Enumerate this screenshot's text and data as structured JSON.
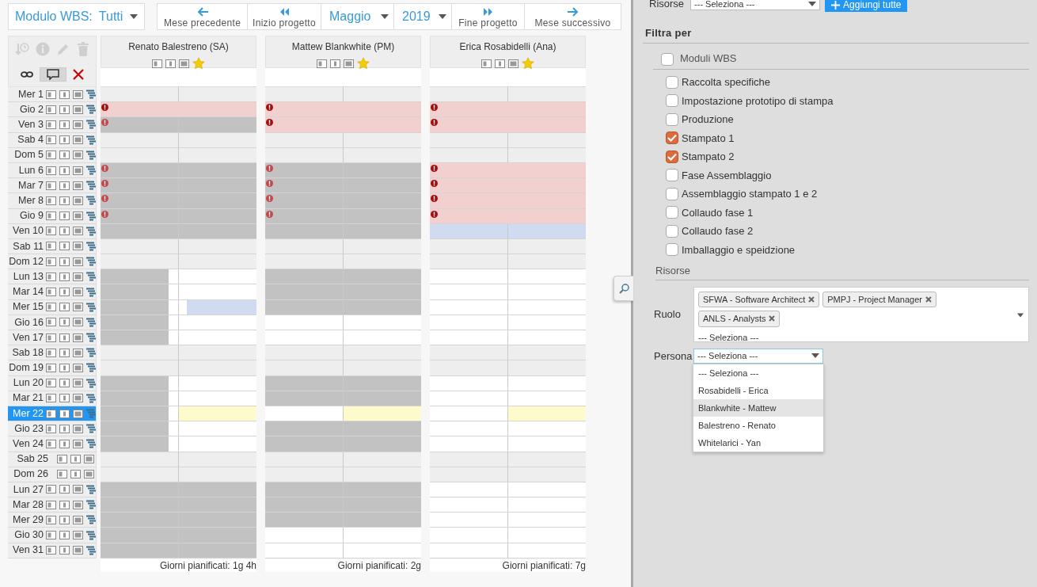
{
  "wbs_filter": {
    "label": "Modulo WBS:",
    "value": "Tutti"
  },
  "nav": [
    {
      "kind": "prev",
      "label": "Mese precedente"
    },
    {
      "kind": "start",
      "label": "Inizio progetto"
    },
    {
      "kind": "select",
      "value": "Maggio"
    },
    {
      "kind": "select",
      "value": "2019"
    },
    {
      "kind": "end",
      "label": "Fine progetto"
    },
    {
      "kind": "next",
      "label": "Mese successivo"
    }
  ],
  "tools": [
    {
      "kind": "history",
      "disabled": true
    },
    {
      "kind": "info",
      "disabled": true
    },
    {
      "kind": "edit",
      "disabled": true
    },
    {
      "kind": "delete",
      "disabled": true
    }
  ],
  "view_tools": [
    {
      "kind": "link",
      "on": false
    },
    {
      "kind": "comment",
      "on": true
    },
    {
      "kind": "clear",
      "on": false
    }
  ],
  "days": [
    {
      "label": "Mer 1",
      "selected": false,
      "gantt": true
    },
    {
      "label": "Gio 2",
      "selected": false,
      "gantt": true
    },
    {
      "label": "Ven 3",
      "selected": false,
      "gantt": true
    },
    {
      "label": "Sab 4",
      "selected": false,
      "gantt": true
    },
    {
      "label": "Dom 5",
      "selected": false,
      "gantt": true
    },
    {
      "label": "Lun 6",
      "selected": false,
      "gantt": true
    },
    {
      "label": "Mar 7",
      "selected": false,
      "gantt": true
    },
    {
      "label": "Mer 8",
      "selected": false,
      "gantt": true
    },
    {
      "label": "Gio 9",
      "selected": false,
      "gantt": true
    },
    {
      "label": "Ven 10",
      "selected": false,
      "gantt": true
    },
    {
      "label": "Sab 11",
      "selected": false,
      "gantt": true
    },
    {
      "label": "Dom 12",
      "selected": false,
      "gantt": true
    },
    {
      "label": "Lun 13",
      "selected": false,
      "gantt": true
    },
    {
      "label": "Mar 14",
      "selected": false,
      "gantt": true
    },
    {
      "label": "Mer 15",
      "selected": false,
      "gantt": true
    },
    {
      "label": "Gio 16",
      "selected": false,
      "gantt": true
    },
    {
      "label": "Ven 17",
      "selected": false,
      "gantt": true
    },
    {
      "label": "Sab 18",
      "selected": false,
      "gantt": true
    },
    {
      "label": "Dom 19",
      "selected": false,
      "gantt": true
    },
    {
      "label": "Lun 20",
      "selected": false,
      "gantt": true
    },
    {
      "label": "Mar 21",
      "selected": false,
      "gantt": true
    },
    {
      "label": "Mer 22",
      "selected": true,
      "gantt": true
    },
    {
      "label": "Gio 23",
      "selected": false,
      "gantt": true
    },
    {
      "label": "Ven 24",
      "selected": false,
      "gantt": true
    },
    {
      "label": "Sab 25",
      "selected": false,
      "gantt": false
    },
    {
      "label": "Dom 26",
      "selected": false,
      "gantt": false
    },
    {
      "label": "Lun 27",
      "selected": false,
      "gantt": true
    },
    {
      "label": "Mar 28",
      "selected": false,
      "gantt": true
    },
    {
      "label": "Mer 29",
      "selected": false,
      "gantt": true
    },
    {
      "label": "Gio 30",
      "selected": false,
      "gantt": true
    },
    {
      "label": "Ven 31",
      "selected": false,
      "gantt": true
    }
  ],
  "people": [
    {
      "name": "Renato Balestreno (SA)",
      "starred": true,
      "total": "Giorni pianificati: 1g 4h",
      "cells": [
        {
          "alert": false,
          "halves": [
            {
              "kind": "off"
            },
            {
              "kind": "off"
            }
          ]
        },
        {
          "alert": true,
          "halves": [
            {
              "kind": "conflict"
            },
            {
              "kind": "conflict"
            }
          ]
        },
        {
          "alert": true,
          "halves": [
            {
              "kind": "busy"
            },
            {
              "kind": "busy"
            }
          ]
        },
        {
          "alert": false,
          "halves": [
            {
              "kind": "off"
            },
            {
              "kind": "off"
            }
          ]
        },
        {
          "alert": false,
          "halves": [
            {
              "kind": "off"
            },
            {
              "kind": "off"
            }
          ]
        },
        {
          "alert": true,
          "halves": [
            {
              "kind": "busy"
            },
            {
              "kind": "busy"
            }
          ]
        },
        {
          "alert": true,
          "halves": [
            {
              "kind": "busy"
            },
            {
              "kind": "busy"
            }
          ]
        },
        {
          "alert": true,
          "halves": [
            {
              "kind": "busy"
            },
            {
              "kind": "busy"
            }
          ]
        },
        {
          "alert": true,
          "halves": [
            {
              "kind": "busy"
            },
            {
              "kind": "busy"
            }
          ]
        },
        {
          "alert": false,
          "halves": [
            {
              "kind": "busy"
            },
            {
              "kind": "busy"
            }
          ]
        },
        {
          "alert": false,
          "halves": [
            {
              "kind": "off"
            },
            {
              "kind": "off"
            }
          ]
        },
        {
          "alert": false,
          "halves": [
            {
              "kind": "off"
            },
            {
              "kind": "off"
            }
          ]
        },
        {
          "alert": false,
          "halves": [
            {
              "kind": "busy_partial"
            },
            {
              "kind": "free"
            }
          ]
        },
        {
          "alert": false,
          "halves": [
            {
              "kind": "busy_partial"
            },
            {
              "kind": "free"
            }
          ]
        },
        {
          "alert": false,
          "halves": [
            {
              "kind": "busy_partial"
            },
            {
              "kind": "planned_partial"
            }
          ]
        },
        {
          "alert": false,
          "halves": [
            {
              "kind": "busy_partial"
            },
            {
              "kind": "free"
            }
          ]
        },
        {
          "alert": false,
          "halves": [
            {
              "kind": "busy_partial"
            },
            {
              "kind": "free"
            }
          ]
        },
        {
          "alert": false,
          "halves": [
            {
              "kind": "off"
            },
            {
              "kind": "off"
            }
          ]
        },
        {
          "alert": false,
          "halves": [
            {
              "kind": "off"
            },
            {
              "kind": "off"
            }
          ]
        },
        {
          "alert": false,
          "halves": [
            {
              "kind": "busy_partial"
            },
            {
              "kind": "free"
            }
          ]
        },
        {
          "alert": false,
          "halves": [
            {
              "kind": "busy_partial"
            },
            {
              "kind": "free"
            }
          ]
        },
        {
          "alert": false,
          "halves": [
            {
              "kind": "busy_partial"
            },
            {
              "kind": "today"
            }
          ]
        },
        {
          "alert": false,
          "halves": [
            {
              "kind": "busy_partial"
            },
            {
              "kind": "free"
            }
          ]
        },
        {
          "alert": false,
          "halves": [
            {
              "kind": "busy_partial"
            },
            {
              "kind": "free"
            }
          ]
        },
        {
          "alert": false,
          "halves": [
            {
              "kind": "off"
            },
            {
              "kind": "off"
            }
          ]
        },
        {
          "alert": false,
          "halves": [
            {
              "kind": "off"
            },
            {
              "kind": "off"
            }
          ]
        },
        {
          "alert": false,
          "halves": [
            {
              "kind": "busy"
            },
            {
              "kind": "busy"
            }
          ]
        },
        {
          "alert": false,
          "halves": [
            {
              "kind": "busy"
            },
            {
              "kind": "busy"
            }
          ]
        },
        {
          "alert": false,
          "halves": [
            {
              "kind": "busy"
            },
            {
              "kind": "busy"
            }
          ]
        },
        {
          "alert": false,
          "halves": [
            {
              "kind": "busy"
            },
            {
              "kind": "busy"
            }
          ]
        },
        {
          "alert": false,
          "halves": [
            {
              "kind": "busy"
            },
            {
              "kind": "busy"
            }
          ]
        }
      ]
    },
    {
      "name": "Mattew Blankwhite (PM)",
      "starred": true,
      "total": "Giorni pianificati: 2g",
      "cells": [
        {
          "alert": false,
          "halves": [
            {
              "kind": "off"
            },
            {
              "kind": "off"
            }
          ]
        },
        {
          "alert": true,
          "halves": [
            {
              "kind": "conflict"
            },
            {
              "kind": "conflict"
            }
          ]
        },
        {
          "alert": true,
          "halves": [
            {
              "kind": "conflict"
            },
            {
              "kind": "conflict"
            }
          ]
        },
        {
          "alert": false,
          "halves": [
            {
              "kind": "off"
            },
            {
              "kind": "off"
            }
          ]
        },
        {
          "alert": false,
          "halves": [
            {
              "kind": "off"
            },
            {
              "kind": "off"
            }
          ]
        },
        {
          "alert": true,
          "halves": [
            {
              "kind": "busy"
            },
            {
              "kind": "busy"
            }
          ]
        },
        {
          "alert": true,
          "halves": [
            {
              "kind": "busy"
            },
            {
              "kind": "busy"
            }
          ]
        },
        {
          "alert": true,
          "halves": [
            {
              "kind": "busy"
            },
            {
              "kind": "busy"
            }
          ]
        },
        {
          "alert": true,
          "halves": [
            {
              "kind": "busy"
            },
            {
              "kind": "busy"
            }
          ]
        },
        {
          "alert": false,
          "halves": [
            {
              "kind": "busy"
            },
            {
              "kind": "busy"
            }
          ]
        },
        {
          "alert": false,
          "halves": [
            {
              "kind": "off"
            },
            {
              "kind": "off"
            }
          ]
        },
        {
          "alert": false,
          "halves": [
            {
              "kind": "off"
            },
            {
              "kind": "off"
            }
          ]
        },
        {
          "alert": false,
          "halves": [
            {
              "kind": "busy"
            },
            {
              "kind": "busy"
            }
          ]
        },
        {
          "alert": false,
          "halves": [
            {
              "kind": "busy"
            },
            {
              "kind": "busy"
            }
          ]
        },
        {
          "alert": false,
          "halves": [
            {
              "kind": "busy"
            },
            {
              "kind": "busy"
            }
          ]
        },
        {
          "alert": false,
          "halves": [
            {
              "kind": "free"
            },
            {
              "kind": "free"
            }
          ]
        },
        {
          "alert": false,
          "halves": [
            {
              "kind": "free"
            },
            {
              "kind": "free"
            }
          ]
        },
        {
          "alert": false,
          "halves": [
            {
              "kind": "off"
            },
            {
              "kind": "off"
            }
          ]
        },
        {
          "alert": false,
          "halves": [
            {
              "kind": "off"
            },
            {
              "kind": "off"
            }
          ]
        },
        {
          "alert": false,
          "halves": [
            {
              "kind": "busy"
            },
            {
              "kind": "busy"
            }
          ]
        },
        {
          "alert": false,
          "halves": [
            {
              "kind": "busy"
            },
            {
              "kind": "busy"
            }
          ]
        },
        {
          "alert": false,
          "halves": [
            {
              "kind": "free"
            },
            {
              "kind": "today"
            }
          ]
        },
        {
          "alert": false,
          "halves": [
            {
              "kind": "busy"
            },
            {
              "kind": "busy"
            }
          ]
        },
        {
          "alert": false,
          "halves": [
            {
              "kind": "busy"
            },
            {
              "kind": "busy"
            }
          ]
        },
        {
          "alert": false,
          "halves": [
            {
              "kind": "off"
            },
            {
              "kind": "off"
            }
          ]
        },
        {
          "alert": false,
          "halves": [
            {
              "kind": "off"
            },
            {
              "kind": "off"
            }
          ]
        },
        {
          "alert": false,
          "halves": [
            {
              "kind": "busy"
            },
            {
              "kind": "busy"
            }
          ]
        },
        {
          "alert": false,
          "halves": [
            {
              "kind": "busy"
            },
            {
              "kind": "busy"
            }
          ]
        },
        {
          "alert": false,
          "halves": [
            {
              "kind": "busy"
            },
            {
              "kind": "busy"
            }
          ]
        },
        {
          "alert": false,
          "halves": [
            {
              "kind": "free"
            },
            {
              "kind": "free"
            }
          ]
        },
        {
          "alert": false,
          "halves": [
            {
              "kind": "free"
            },
            {
              "kind": "free"
            }
          ]
        }
      ]
    },
    {
      "name": "Erica Rosabidelli (Ana)",
      "starred": true,
      "total": "Giorni pianificati: 7g",
      "cells": [
        {
          "alert": false,
          "halves": [
            {
              "kind": "off"
            },
            {
              "kind": "off"
            }
          ]
        },
        {
          "alert": true,
          "halves": [
            {
              "kind": "conflict"
            },
            {
              "kind": "conflict"
            }
          ]
        },
        {
          "alert": true,
          "halves": [
            {
              "kind": "conflict"
            },
            {
              "kind": "conflict"
            }
          ]
        },
        {
          "alert": false,
          "halves": [
            {
              "kind": "off"
            },
            {
              "kind": "off"
            }
          ]
        },
        {
          "alert": false,
          "halves": [
            {
              "kind": "off"
            },
            {
              "kind": "off"
            }
          ]
        },
        {
          "alert": true,
          "halves": [
            {
              "kind": "conflict"
            },
            {
              "kind": "conflict"
            }
          ]
        },
        {
          "alert": true,
          "halves": [
            {
              "kind": "conflict"
            },
            {
              "kind": "conflict"
            }
          ]
        },
        {
          "alert": true,
          "halves": [
            {
              "kind": "conflict"
            },
            {
              "kind": "conflict"
            }
          ]
        },
        {
          "alert": true,
          "halves": [
            {
              "kind": "conflict"
            },
            {
              "kind": "conflict"
            }
          ]
        },
        {
          "alert": false,
          "halves": [
            {
              "kind": "planned"
            },
            {
              "kind": "planned"
            }
          ]
        },
        {
          "alert": false,
          "halves": [
            {
              "kind": "off"
            },
            {
              "kind": "off"
            }
          ]
        },
        {
          "alert": false,
          "halves": [
            {
              "kind": "off"
            },
            {
              "kind": "off"
            }
          ]
        },
        {
          "alert": false,
          "halves": [
            {
              "kind": "free"
            },
            {
              "kind": "free"
            }
          ]
        },
        {
          "alert": false,
          "halves": [
            {
              "kind": "free"
            },
            {
              "kind": "free"
            }
          ]
        },
        {
          "alert": false,
          "halves": [
            {
              "kind": "free"
            },
            {
              "kind": "free"
            }
          ]
        },
        {
          "alert": false,
          "halves": [
            {
              "kind": "free"
            },
            {
              "kind": "free"
            }
          ]
        },
        {
          "alert": false,
          "halves": [
            {
              "kind": "free"
            },
            {
              "kind": "free"
            }
          ]
        },
        {
          "alert": false,
          "halves": [
            {
              "kind": "off"
            },
            {
              "kind": "off"
            }
          ]
        },
        {
          "alert": false,
          "halves": [
            {
              "kind": "off"
            },
            {
              "kind": "off"
            }
          ]
        },
        {
          "alert": false,
          "halves": [
            {
              "kind": "free"
            },
            {
              "kind": "free"
            }
          ]
        },
        {
          "alert": false,
          "halves": [
            {
              "kind": "free"
            },
            {
              "kind": "free"
            }
          ]
        },
        {
          "alert": false,
          "halves": [
            {
              "kind": "free"
            },
            {
              "kind": "today"
            }
          ]
        },
        {
          "alert": false,
          "halves": [
            {
              "kind": "free"
            },
            {
              "kind": "free"
            }
          ]
        },
        {
          "alert": false,
          "halves": [
            {
              "kind": "free"
            },
            {
              "kind": "free"
            }
          ]
        },
        {
          "alert": false,
          "halves": [
            {
              "kind": "off"
            },
            {
              "kind": "off"
            }
          ]
        },
        {
          "alert": false,
          "halves": [
            {
              "kind": "off"
            },
            {
              "kind": "off"
            }
          ]
        },
        {
          "alert": false,
          "halves": [
            {
              "kind": "free"
            },
            {
              "kind": "free"
            }
          ]
        },
        {
          "alert": false,
          "halves": [
            {
              "kind": "free"
            },
            {
              "kind": "free"
            }
          ]
        },
        {
          "alert": false,
          "halves": [
            {
              "kind": "free"
            },
            {
              "kind": "free"
            }
          ]
        },
        {
          "alert": false,
          "halves": [
            {
              "kind": "free"
            },
            {
              "kind": "free"
            }
          ]
        },
        {
          "alert": false,
          "halves": [
            {
              "kind": "free"
            },
            {
              "kind": "free"
            }
          ]
        }
      ]
    }
  ],
  "panel": {
    "resources_row": {
      "label": "Risorse",
      "select": "--- Seleziona ---",
      "button": "Aggiungi tutte"
    },
    "filter_title": "Filtra per",
    "group": {
      "label": "Moduli WBS",
      "checked": false
    },
    "modules": [
      {
        "label": "Raccolta specifiche",
        "checked": false
      },
      {
        "label": "Impostazione prototipo di stampa",
        "checked": false
      },
      {
        "label": "Produzione",
        "checked": false
      },
      {
        "label": "Stampato 1",
        "checked": true
      },
      {
        "label": "Stampato 2",
        "checked": true
      },
      {
        "label": "Fase Assemblaggio",
        "checked": false
      },
      {
        "label": "Assemblaggio stampato 1 e 2",
        "checked": false
      },
      {
        "label": "Collaudo fase 1",
        "checked": false
      },
      {
        "label": "Collaudo fase 2",
        "checked": false
      },
      {
        "label": "Imballaggio e speidzione",
        "checked": false
      }
    ],
    "resources_title": "Risorse",
    "role": {
      "label": "Ruolo",
      "tags": [
        "SFWA - Software Architect",
        "PMPJ - Project Manager",
        "ANLS - Analysts"
      ],
      "placeholder": "--- Seleziona ---"
    },
    "person": {
      "label": "Persona",
      "value": "--- Seleziona ---",
      "expanded": true,
      "options": [
        {
          "label": "--- Seleziona ---",
          "highlighted": false
        },
        {
          "label": "Rosabidelli - Erica",
          "highlighted": false
        },
        {
          "label": "Blankwhite - Mattew",
          "highlighted": true
        },
        {
          "label": "Balestreno - Renato",
          "highlighted": false
        },
        {
          "label": "Whitelarici - Yan",
          "highlighted": false
        }
      ]
    }
  }
}
